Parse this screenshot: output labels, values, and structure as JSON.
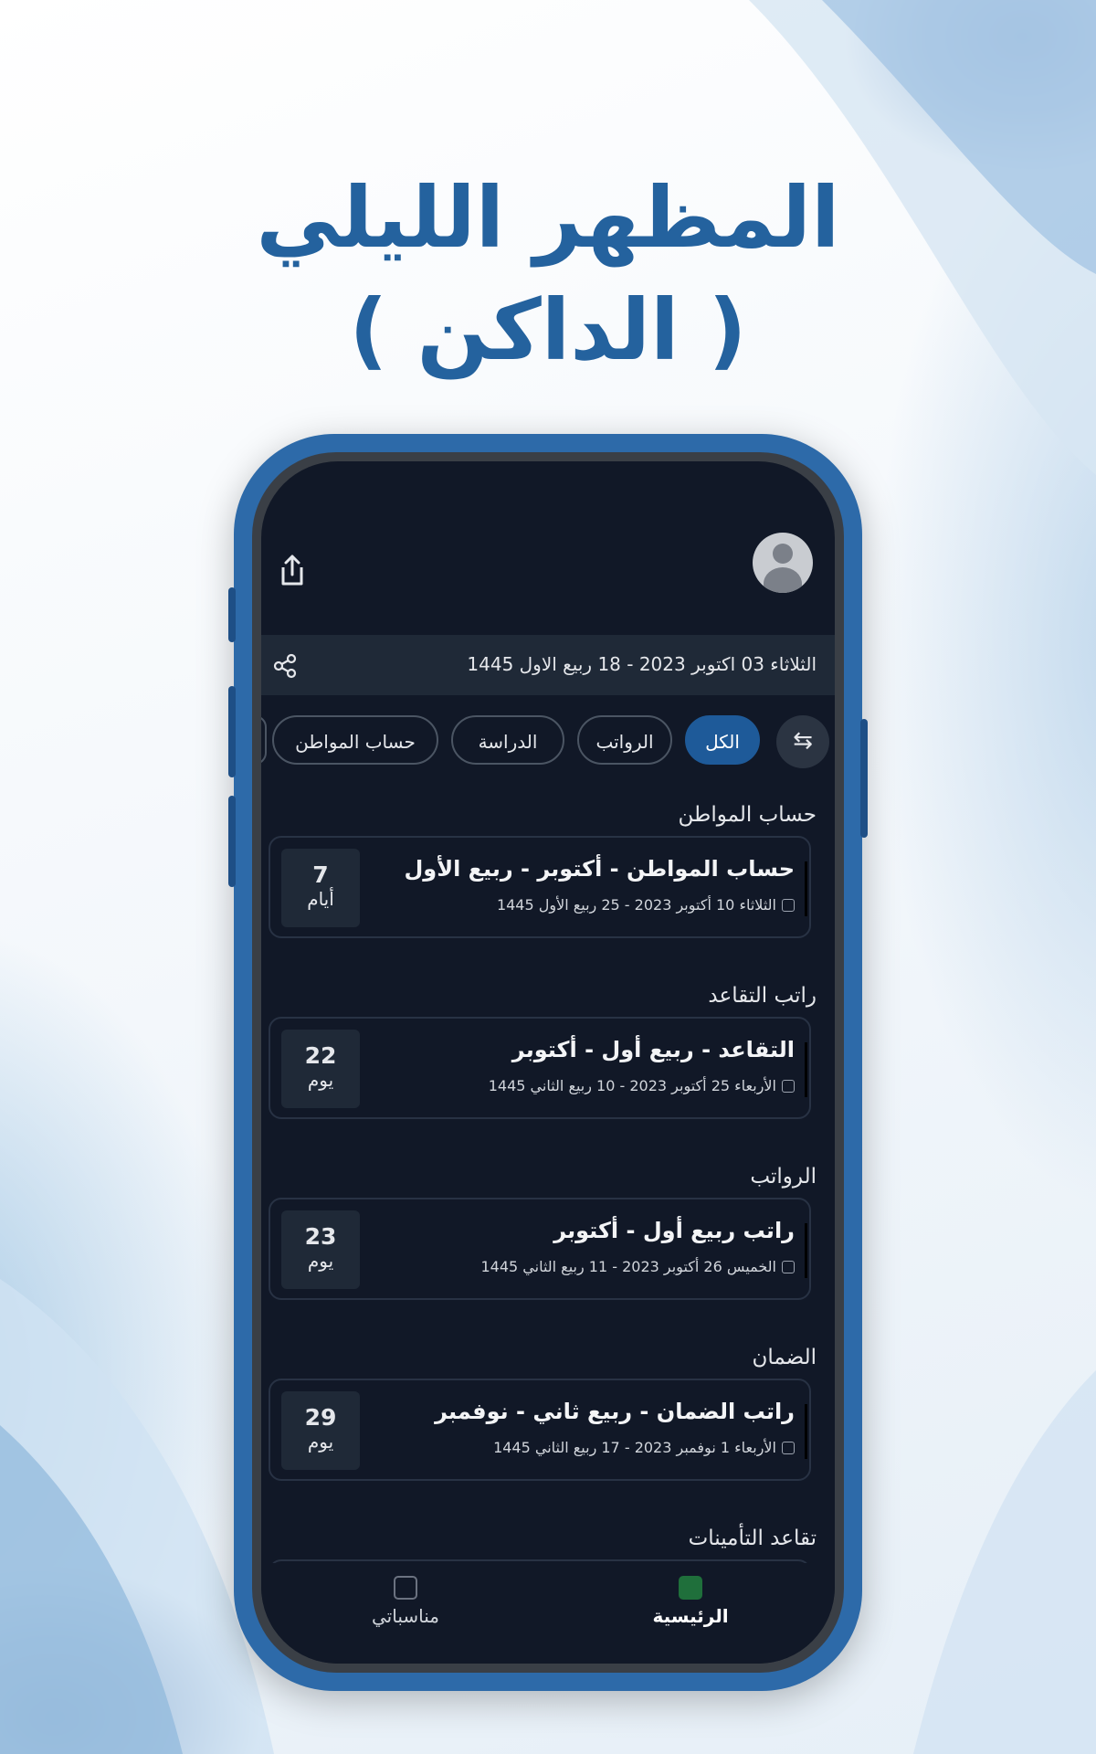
{
  "promo": {
    "line1": "المظهر الليلي",
    "line2": "( الداكن )"
  },
  "header": {
    "date_text": "الثلاثاء 03 اكتوبر 2023 - 18 ربيع الاول 1445"
  },
  "filters": {
    "chips": [
      {
        "label": "الكل",
        "active": true
      },
      {
        "label": "الرواتب",
        "active": false
      },
      {
        "label": "الدراسة",
        "active": false
      },
      {
        "label": "حساب المواطن",
        "active": false
      }
    ]
  },
  "sections": [
    {
      "title": "حساب المواطن",
      "card": {
        "title": "حساب المواطن - أكتوبر - ربيع الأول",
        "date": "الثلاثاء 10 أكتوبر 2023 - 25 ربيع الأول 1445",
        "count": "7",
        "unit": "أيام"
      }
    },
    {
      "title": "راتب التقاعد",
      "card": {
        "title": "التقاعد - ربيع أول - أكتوبر",
        "date": "الأربعاء 25 أكتوبر 2023 - 10 ربيع الثاني 1445",
        "count": "22",
        "unit": "يوم"
      }
    },
    {
      "title": "الرواتب",
      "card": {
        "title": "راتب ربيع أول - أكتوبر",
        "date": "الخميس 26 أكتوبر 2023 - 11 ربيع الثاني 1445",
        "count": "23",
        "unit": "يوم"
      }
    },
    {
      "title": "الضمان",
      "card": {
        "title": "راتب الضمان - ربيع ثاني - نوفمبر",
        "date": "الأربعاء 1 نوفمبر 2023 - 17 ربيع الثاني 1445",
        "count": "29",
        "unit": "يوم"
      }
    },
    {
      "title": "تقاعد التأمينات"
    }
  ],
  "bottom_nav": {
    "home": {
      "label": "الرئيسية",
      "icon": "calendar-icon",
      "active": true
    },
    "mine": {
      "label": "مناسباتي",
      "icon": "calendar-icon",
      "active": false
    }
  },
  "colors": {
    "accent": "#1e5a99",
    "screen_bg": "#111827",
    "home_icon": "#1f6f3b"
  }
}
